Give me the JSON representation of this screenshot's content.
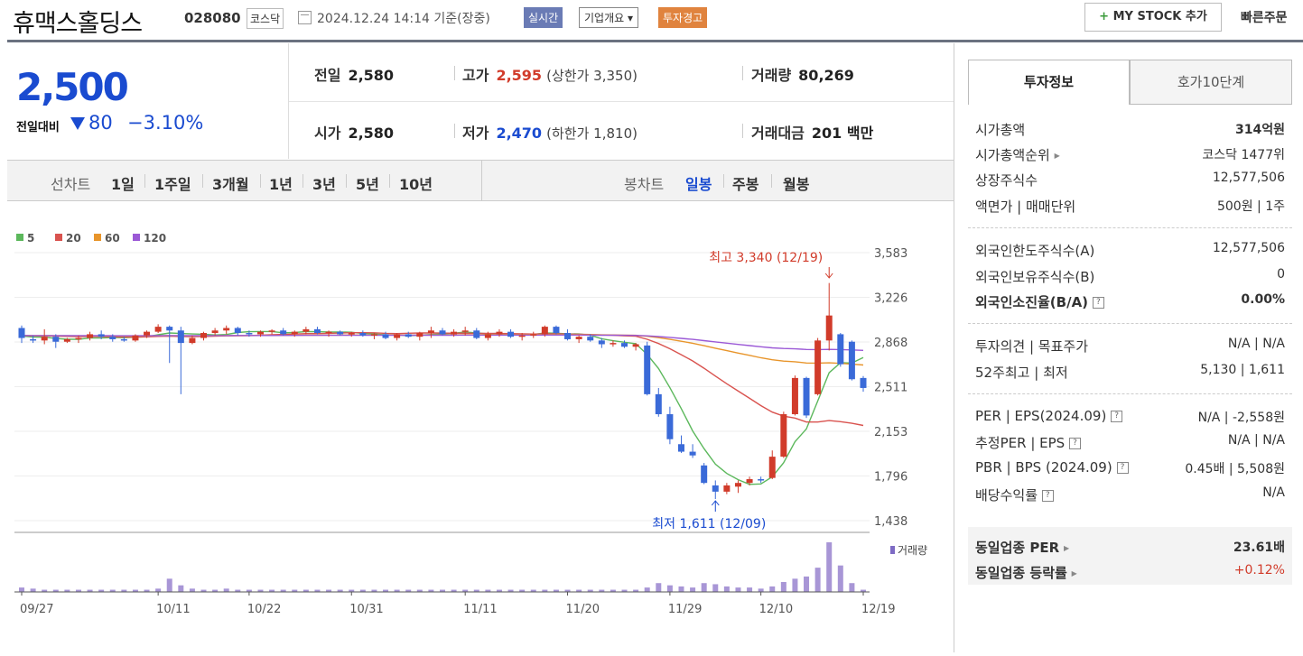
{
  "header": {
    "company": "휴맥스홀딩스",
    "code": "028080",
    "market": "코스닥",
    "datetime": "2024.12.24 14:14  기준(장중)",
    "realtime": "실시간",
    "company_info": "기업개요 ▾",
    "warning": "투자경고",
    "mystock": "MY STOCK 추가",
    "quick_order": "빠른주문"
  },
  "price": {
    "current": "2,500",
    "diff_label": "전일대비",
    "diff_value": "80",
    "diff_pct": "−3.10%"
  },
  "stats": {
    "prev_label": "전일",
    "prev": "2,580",
    "high_label": "고가",
    "high": "2,595",
    "upper_limit": "(상한가 3,350)",
    "volume_label": "거래량",
    "volume": "80,269",
    "open_label": "시가",
    "open": "2,580",
    "low_label": "저가",
    "low": "2,470",
    "lower_limit": "(하한가 1,810)",
    "amount_label": "거래대금",
    "amount": "201 백만"
  },
  "period": {
    "line_label": "선차트",
    "items": [
      "1일",
      "1주일",
      "3개월",
      "1년",
      "3년",
      "5년",
      "10년"
    ],
    "candle_label": "봉차트",
    "candles": [
      "일봉",
      "주봉",
      "월봉"
    ]
  },
  "chart_data": {
    "type": "candlestick",
    "legend": [
      "5",
      "20",
      "60",
      "120"
    ],
    "legend_colors": [
      "#5cb85c",
      "#d9534f",
      "#e8952b",
      "#9b59d6"
    ],
    "y_ticks": [
      "3,583",
      "3,226",
      "2,868",
      "2,511",
      "2,153",
      "1,796",
      "1,438"
    ],
    "ylim": [
      1438,
      3583
    ],
    "x_labels": [
      "09/27",
      "10/11",
      "10/22",
      "10/31",
      "11/11",
      "11/20",
      "11/29",
      "12/10",
      "12/19"
    ],
    "high_note": "최고 3,340 (12/19)",
    "low_note": "최저 1,611 (12/09)",
    "volume_legend": "거래량",
    "candles": [
      [
        2980,
        3000,
        2860,
        2900
      ],
      [
        2890,
        2920,
        2860,
        2880
      ],
      [
        2880,
        2970,
        2850,
        2910
      ],
      [
        2910,
        2930,
        2820,
        2870
      ],
      [
        2870,
        2900,
        2860,
        2890
      ],
      [
        2890,
        2920,
        2860,
        2900
      ],
      [
        2900,
        2950,
        2880,
        2930
      ],
      [
        2930,
        2960,
        2890,
        2910
      ],
      [
        2910,
        2930,
        2870,
        2890
      ],
      [
        2890,
        2910,
        2870,
        2880
      ],
      [
        2880,
        2930,
        2870,
        2920
      ],
      [
        2920,
        2960,
        2900,
        2950
      ],
      [
        2950,
        3010,
        2940,
        2990
      ],
      [
        2990,
        3000,
        2700,
        2960
      ],
      [
        2960,
        2990,
        2450,
        2860
      ],
      [
        2860,
        2920,
        2850,
        2900
      ],
      [
        2900,
        2950,
        2880,
        2940
      ],
      [
        2940,
        2980,
        2920,
        2960
      ],
      [
        2960,
        3000,
        2930,
        2980
      ],
      [
        2980,
        2990,
        2920,
        2940
      ],
      [
        2940,
        2960,
        2910,
        2930
      ],
      [
        2930,
        2960,
        2910,
        2950
      ],
      [
        2950,
        2970,
        2930,
        2960
      ],
      [
        2960,
        2980,
        2920,
        2930
      ],
      [
        2930,
        2960,
        2910,
        2950
      ],
      [
        2950,
        2990,
        2930,
        2970
      ],
      [
        2970,
        2990,
        2930,
        2940
      ],
      [
        2940,
        2960,
        2910,
        2950
      ],
      [
        2950,
        2960,
        2920,
        2930
      ],
      [
        2930,
        2950,
        2910,
        2940
      ],
      [
        2940,
        2960,
        2910,
        2920
      ],
      [
        2920,
        2940,
        2890,
        2930
      ],
      [
        2930,
        2950,
        2890,
        2900
      ],
      [
        2900,
        2940,
        2880,
        2930
      ],
      [
        2930,
        2950,
        2900,
        2910
      ],
      [
        2910,
        2950,
        2880,
        2940
      ],
      [
        2940,
        2990,
        2900,
        2960
      ],
      [
        2960,
        2980,
        2920,
        2930
      ],
      [
        2930,
        2970,
        2910,
        2950
      ],
      [
        2950,
        2990,
        2920,
        2960
      ],
      [
        2960,
        2980,
        2890,
        2900
      ],
      [
        2900,
        2950,
        2880,
        2930
      ],
      [
        2930,
        2970,
        2910,
        2950
      ],
      [
        2950,
        2970,
        2900,
        2910
      ],
      [
        2910,
        2940,
        2880,
        2920
      ],
      [
        2920,
        2950,
        2900,
        2930
      ],
      [
        2930,
        3000,
        2910,
        2990
      ],
      [
        2990,
        3000,
        2930,
        2940
      ],
      [
        2940,
        2970,
        2880,
        2890
      ],
      [
        2890,
        2920,
        2860,
        2910
      ],
      [
        2910,
        2930,
        2870,
        2880
      ],
      [
        2880,
        2900,
        2820,
        2850
      ],
      [
        2850,
        2880,
        2830,
        2860
      ],
      [
        2860,
        2880,
        2820,
        2830
      ],
      [
        2830,
        2860,
        2800,
        2850
      ],
      [
        2840,
        2870,
        2440,
        2450
      ],
      [
        2450,
        2500,
        2270,
        2290
      ],
      [
        2290,
        2350,
        2050,
        2090
      ],
      [
        2050,
        2120,
        1980,
        1990
      ],
      [
        1990,
        2050,
        1940,
        1960
      ],
      [
        1880,
        1900,
        1730,
        1740
      ],
      [
        1720,
        1760,
        1611,
        1670
      ],
      [
        1670,
        1740,
        1650,
        1720
      ],
      [
        1710,
        1760,
        1660,
        1740
      ],
      [
        1740,
        1790,
        1720,
        1770
      ],
      [
        1770,
        1790,
        1740,
        1760
      ],
      [
        1780,
        2000,
        1770,
        1950
      ],
      [
        1950,
        2310,
        1940,
        2290
      ],
      [
        2290,
        2600,
        2280,
        2580
      ],
      [
        2580,
        2590,
        2260,
        2280
      ],
      [
        2450,
        2900,
        2440,
        2880
      ],
      [
        2880,
        3340,
        2800,
        3080
      ],
      [
        2930,
        2940,
        2670,
        2690
      ],
      [
        2870,
        2880,
        2560,
        2570
      ],
      [
        2580,
        2595,
        2470,
        2500
      ]
    ],
    "volumes": [
      4,
      3,
      2,
      2,
      2,
      2,
      2,
      2,
      2,
      2,
      2,
      2,
      3,
      12,
      6,
      3,
      2,
      2,
      3,
      2,
      2,
      2,
      2,
      2,
      2,
      2,
      2,
      2,
      2,
      2,
      2,
      2,
      2,
      2,
      2,
      2,
      2,
      2,
      2,
      2,
      2,
      2,
      2,
      2,
      2,
      2,
      2,
      2,
      2,
      2,
      2,
      2,
      2,
      2,
      2,
      4,
      8,
      6,
      5,
      4,
      8,
      7,
      5,
      4,
      4,
      3,
      5,
      9,
      12,
      14,
      22,
      45,
      24,
      8,
      2
    ]
  },
  "side": {
    "tab_info": "투자정보",
    "tab_orderbook": "호가10단계",
    "rows": [
      {
        "label": "시가총액",
        "value": "314억원"
      },
      {
        "label": "시가총액순위",
        "value": "코스닥 1477위"
      },
      {
        "label": "상장주식수",
        "value": "12,577,506"
      },
      {
        "label": "액면가 | 매매단위",
        "value": "500원 | 1주"
      },
      {
        "label": "외국인한도주식수(A)",
        "value": "12,577,506"
      },
      {
        "label": "외국인보유주식수(B)",
        "value": "0"
      },
      {
        "label": "외국인소진율(B/A)",
        "value": "0.00%"
      },
      {
        "label": "투자의견 | 목표주가",
        "value": "N/A | N/A"
      },
      {
        "label": "52주최고 | 최저",
        "value": "5,130 | 1,611"
      },
      {
        "label": "PER | EPS(2024.09)",
        "value": "N/A | -2,558원"
      },
      {
        "label": "추정PER | EPS",
        "value": "N/A | N/A"
      },
      {
        "label": "PBR | BPS (2024.09)",
        "value": "0.45배 | 5,508원"
      },
      {
        "label": "배당수익률",
        "value": "N/A"
      },
      {
        "label": "동일업종 PER",
        "value": "23.61배"
      },
      {
        "label": "동일업종 등락률",
        "value": "+0.12%"
      }
    ]
  }
}
